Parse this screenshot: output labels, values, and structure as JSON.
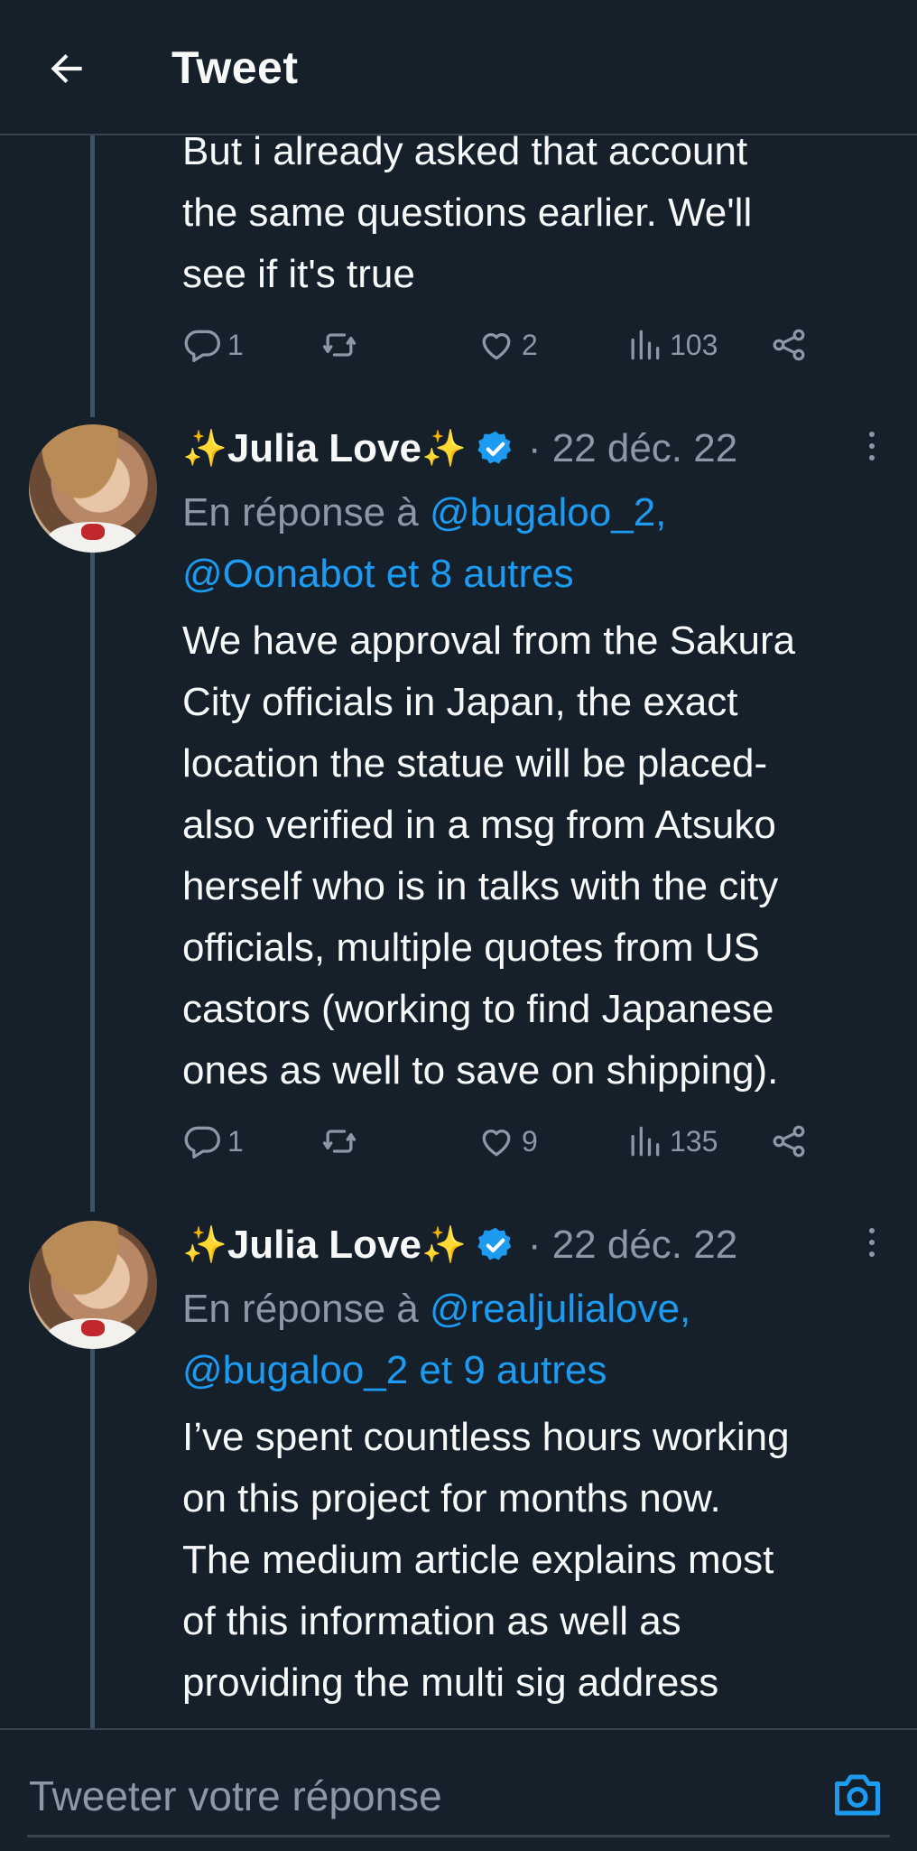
{
  "header": {
    "title": "Tweet"
  },
  "tweets": [
    {
      "text_lines": [
        "But i already asked that account",
        "the same questions earlier. We'll",
        "see if it's true"
      ],
      "replies": "1",
      "retweets": "",
      "likes": "2",
      "views": "103"
    },
    {
      "author": "Julia Love",
      "sparkle_left": "✨",
      "sparkle_right": "✨",
      "date": "· 22 déc. 22",
      "reply_prefix": "En réponse à ",
      "reply_mention_1": "@bugaloo_2,",
      "reply_mention_2": "@Oonabot et 8 autres",
      "text_lines": [
        "We have approval from the Sakura",
        "City officials in Japan, the exact",
        "location the statue will be placed-",
        "also verified in a msg from Atsuko",
        "herself who is in talks with the city",
        "officials, multiple quotes from US",
        "castors (working to find Japanese",
        "ones as well to save on shipping)."
      ],
      "replies": "1",
      "retweets": "",
      "likes": "9",
      "views": "135"
    },
    {
      "author": "Julia Love",
      "sparkle_left": "✨",
      "sparkle_right": "✨",
      "date": "· 22 déc. 22",
      "reply_prefix": "En réponse à ",
      "reply_mention_1": "@realjulialove,",
      "reply_mention_2": "@bugaloo_2 et 9 autres",
      "text_lines": [
        "I’ve spent countless hours working",
        "on this project for months now.",
        "The medium article explains most",
        "of this information as well as",
        "providing the multi sig address"
      ]
    }
  ],
  "reply_box": {
    "placeholder": "Tweeter votre réponse"
  },
  "icons": {
    "back": "arrow-left-icon",
    "reply": "reply-bubble-icon",
    "retweet": "retweet-icon",
    "like": "heart-icon",
    "views": "views-bar-chart-icon",
    "share": "share-icon",
    "verified": "verified-badge-icon",
    "more": "more-dots-icon",
    "camera": "camera-icon"
  },
  "colors": {
    "background": "#15202b",
    "text": "#f7f9f9",
    "muted": "#8b98a5",
    "accent": "#1d9bf0",
    "border": "#38444d"
  }
}
